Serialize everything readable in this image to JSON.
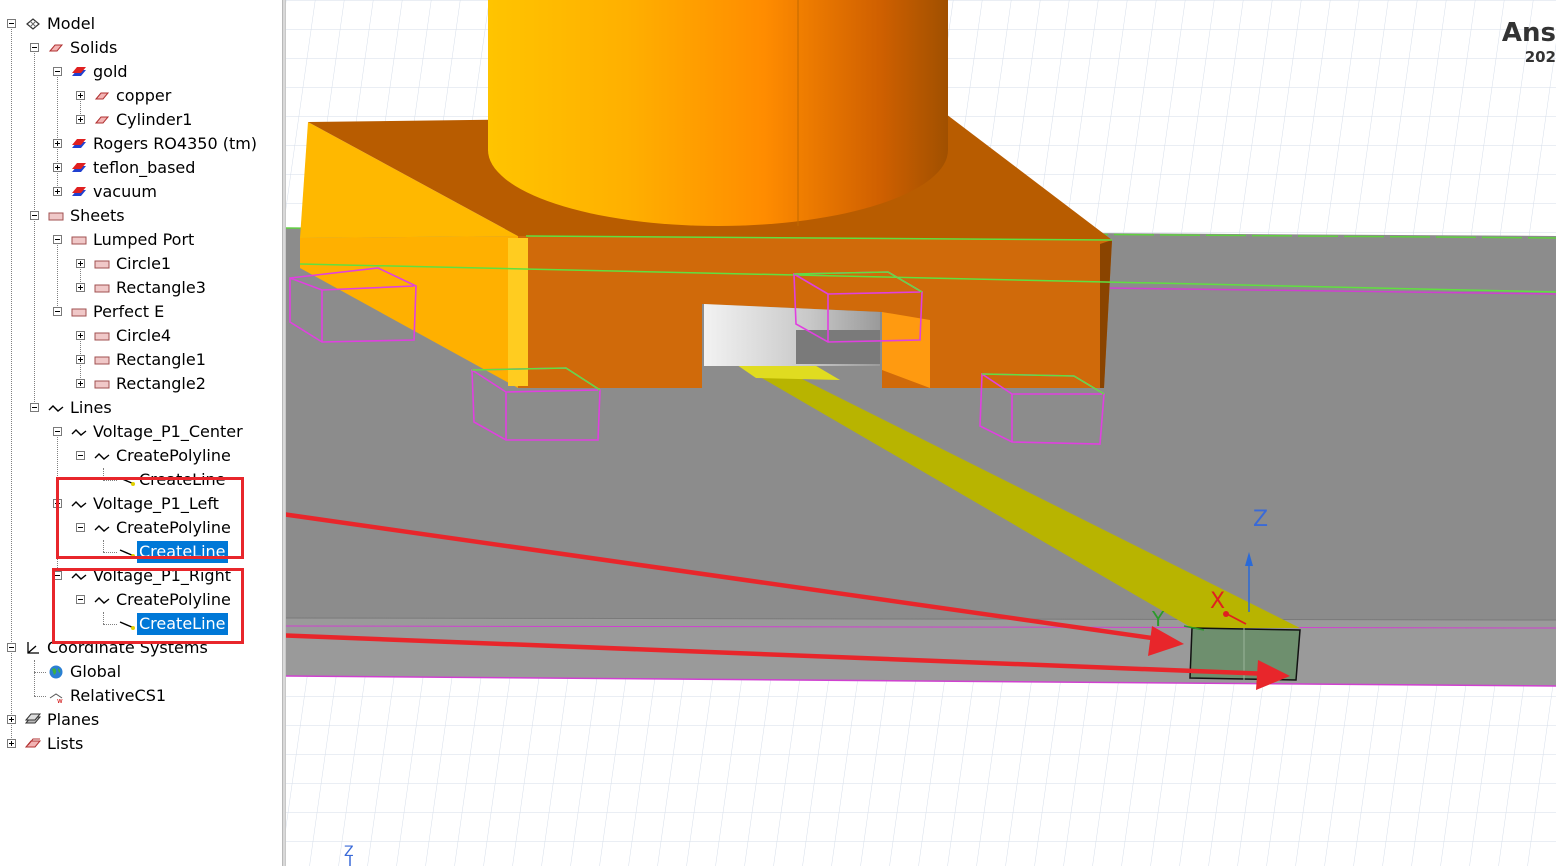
{
  "tree": {
    "model": "Model",
    "solids": "Solids",
    "gold": "gold",
    "copper": "copper",
    "cylinder1": "Cylinder1",
    "rogers": "Rogers RO4350 (tm)",
    "teflon": "teflon_based",
    "vacuum": "vacuum",
    "sheets": "Sheets",
    "lumped_port": "Lumped Port",
    "circle1": "Circle1",
    "rectangle3": "Rectangle3",
    "perfect_e": "Perfect E",
    "circle4": "Circle4",
    "rectangle1": "Rectangle1",
    "rectangle2": "Rectangle2",
    "lines": "Lines",
    "v_center": "Voltage_P1_Center",
    "v_center_poly": "CreatePolyline",
    "v_center_line": "CreateLine",
    "v_left": "Voltage_P1_Left",
    "v_left_poly": "CreatePolyline",
    "v_left_line": "CreateLine",
    "v_right": "Voltage_P1_Right",
    "v_right_poly": "CreatePolyline",
    "v_right_line": "CreateLine",
    "coord_systems": "Coordinate Systems",
    "global": "Global",
    "relcs": "RelativeCS1",
    "planes": "Planes",
    "lists": "Lists"
  },
  "viewport": {
    "brand": "Ans",
    "year": "202",
    "axis_z": "Z",
    "axis_x": "X",
    "axis_y": "Y",
    "mini_z": "Z"
  },
  "colors": {
    "selection": "#0078d7",
    "annotation_red": "#e8262b",
    "pcb_gray": "#8c8c8c",
    "connector_orange": "#d2691e",
    "trace_yellow": "#b8b400",
    "wire_magenta": "#e040e0",
    "wire_green": "#6ee040"
  }
}
